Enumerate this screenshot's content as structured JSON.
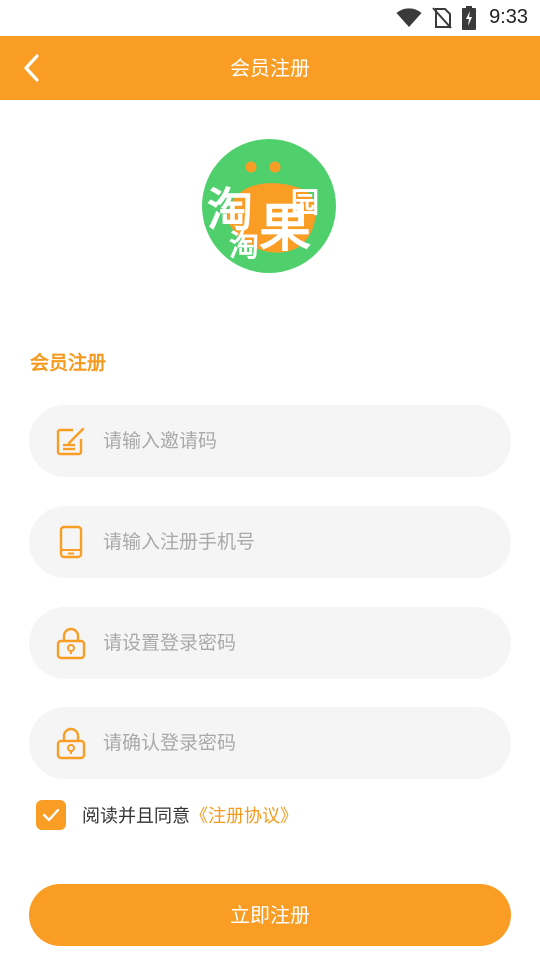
{
  "status_bar": {
    "time": "9:33",
    "icons": [
      "wifi-icon",
      "no-sim-icon",
      "battery-charging-icon"
    ]
  },
  "header": {
    "title": "会员注册",
    "back_icon": "chevron-left-icon"
  },
  "logo": {
    "text_big": "淘",
    "text_small": "淘",
    "text_fruit": "果",
    "text_garden": "园"
  },
  "form": {
    "section_title": "会员注册",
    "fields": [
      {
        "icon": "edit-note-icon",
        "placeholder": "请输入邀请码",
        "value": ""
      },
      {
        "icon": "phone-icon",
        "placeholder": "请输入注册手机号",
        "value": ""
      },
      {
        "icon": "lock-icon",
        "placeholder": "请设置登录密码",
        "value": ""
      },
      {
        "icon": "lock-icon",
        "placeholder": "请确认登录密码",
        "value": ""
      }
    ],
    "agree": {
      "checked": true,
      "text": "阅读并且同意",
      "link": "《注册协议》"
    },
    "submit_label": "立即注册"
  },
  "colors": {
    "accent": "#f99d25",
    "field_bg": "#f5f5f5",
    "logo_green": "#4fd06d",
    "placeholder": "#a9a9a9"
  }
}
